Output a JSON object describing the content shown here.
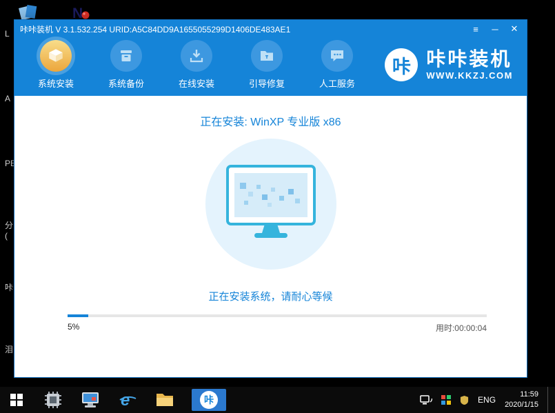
{
  "desktop": {
    "notepad_letter": "N",
    "edge_labels": [
      "L",
      "A",
      "PE",
      "分",
      "(",
      "咔",
      "泪"
    ]
  },
  "window": {
    "title": "咔咔装机 V 3.1.532.254 URID:A5C84DD9A1655055299D1406DE483AE1",
    "controls": {
      "menu": "≡",
      "minimize": "─",
      "close": "✕"
    },
    "toolbar": {
      "items": [
        {
          "label": "系统安装"
        },
        {
          "label": "系统备份"
        },
        {
          "label": "在线安装"
        },
        {
          "label": "引导修复"
        },
        {
          "label": "人工服务"
        }
      ],
      "logo": {
        "mark": "咔",
        "name": "咔咔装机",
        "site": "WWW.KKZJ.COM"
      }
    },
    "content": {
      "installing_title": "正在安装: WinXP 专业版 x86",
      "status_text": "正在安装系统，请耐心等候",
      "progress_percent": "5%",
      "progress_value": 5,
      "elapsed": "用时:00:00:04"
    }
  },
  "taskbar": {
    "kaka_mark": "咔",
    "tray": {
      "lang": "ENG",
      "time": "11:59",
      "date": "2020/1/15"
    }
  },
  "colors": {
    "accent_blue": "#1584d8",
    "active_gold": "#eca63c",
    "illustration_teal": "#35b4dd"
  }
}
